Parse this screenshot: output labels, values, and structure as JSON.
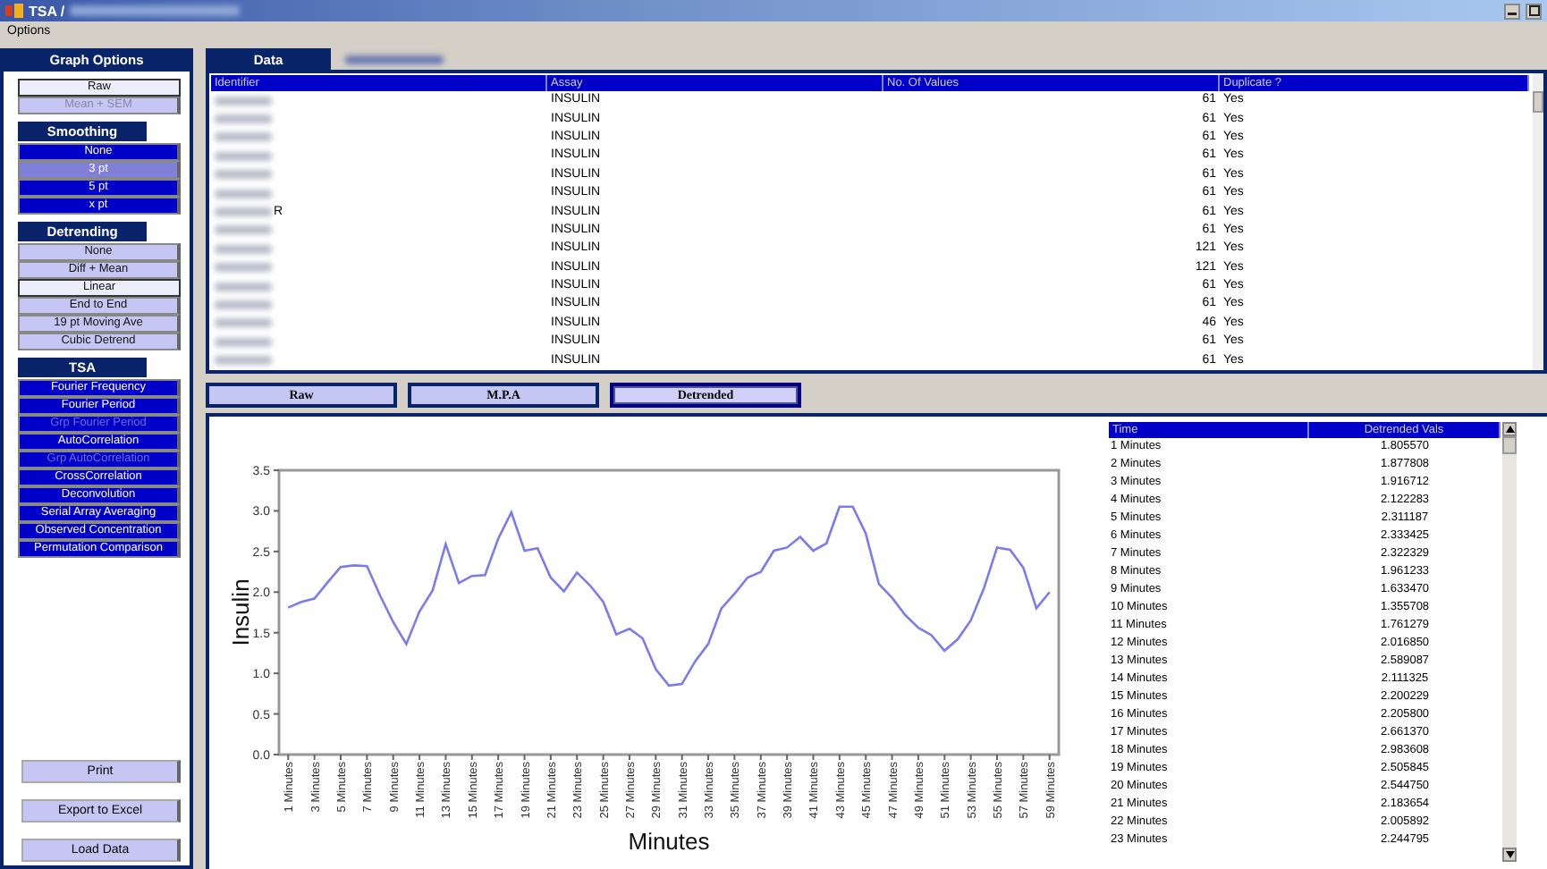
{
  "window": {
    "title": "TSA /"
  },
  "menu": [
    "Options"
  ],
  "sidebar": {
    "title": "Graph Options",
    "groups": [
      {
        "items": [
          {
            "label": "Raw",
            "selected": true,
            "disabled": false
          },
          {
            "label": "Mean + SEM",
            "selected": false,
            "disabled": true
          }
        ]
      },
      {
        "title": "Smoothing",
        "kind": "filled",
        "items": [
          {
            "label": "None",
            "selected": false,
            "disabled": false
          },
          {
            "label": "3 pt",
            "selected": true,
            "disabled": false
          },
          {
            "label": "5 pt",
            "selected": false,
            "disabled": false
          },
          {
            "label": "x pt",
            "selected": false,
            "disabled": false
          }
        ]
      },
      {
        "title": "Detrending",
        "items": [
          {
            "label": "None",
            "selected": false,
            "disabled": false
          },
          {
            "label": "Diff + Mean",
            "selected": false,
            "disabled": false
          },
          {
            "label": "Linear",
            "selected": true,
            "disabled": false
          },
          {
            "label": "End to End",
            "selected": false,
            "disabled": false
          },
          {
            "label": "19 pt Moving Ave",
            "selected": false,
            "disabled": false
          },
          {
            "label": "Cubic Detrend",
            "selected": false,
            "disabled": false
          }
        ]
      },
      {
        "title": "TSA",
        "kind": "filled",
        "items": [
          {
            "label": "Fourier Frequency",
            "selected": false,
            "disabled": false
          },
          {
            "label": "Fourier Period",
            "selected": false,
            "disabled": false
          },
          {
            "label": "Grp Fourier Period",
            "selected": false,
            "disabled": true
          },
          {
            "label": "AutoCorrelation",
            "selected": false,
            "disabled": false
          },
          {
            "label": "Grp AutoCorrelation",
            "selected": false,
            "disabled": true
          },
          {
            "label": "CrossCorrelation",
            "selected": false,
            "disabled": false
          },
          {
            "label": "Deconvolution",
            "selected": false,
            "disabled": false
          },
          {
            "label": "Serial Array Averaging",
            "selected": false,
            "disabled": false
          },
          {
            "label": "Observed Concentration",
            "selected": false,
            "disabled": false
          },
          {
            "label": "Permutation Comparison",
            "selected": false,
            "disabled": false
          }
        ]
      }
    ],
    "actions": [
      "Print",
      "Export to Excel",
      "Load Data"
    ]
  },
  "tabs": [
    {
      "label": "Data",
      "selected": true
    },
    {
      "selected": false
    }
  ],
  "table": {
    "columns": [
      "Identifier",
      "Assay",
      "No. Of Values",
      "Duplicate ?"
    ],
    "rows": [
      {
        "assay": "INSULIN",
        "values": "61",
        "duplicate": "Yes"
      },
      {
        "assay": "INSULIN",
        "values": "61",
        "duplicate": "Yes"
      },
      {
        "assay": "INSULIN",
        "values": "61",
        "duplicate": "Yes"
      },
      {
        "assay": "INSULIN",
        "values": "61",
        "duplicate": "Yes"
      },
      {
        "assay": "INSULIN",
        "values": "61",
        "duplicate": "Yes"
      },
      {
        "assay": "INSULIN",
        "values": "61",
        "duplicate": "Yes"
      },
      {
        "identifier": "R",
        "assay": "INSULIN",
        "values": "61",
        "duplicate": "Yes"
      },
      {
        "assay": "INSULIN",
        "values": "61",
        "duplicate": "Yes"
      },
      {
        "assay": "INSULIN",
        "values": "121",
        "duplicate": "Yes"
      },
      {
        "assay": "INSULIN",
        "values": "121",
        "duplicate": "Yes"
      },
      {
        "assay": "INSULIN",
        "values": "61",
        "duplicate": "Yes"
      },
      {
        "assay": "INSULIN",
        "values": "61",
        "duplicate": "Yes"
      },
      {
        "assay": "INSULIN",
        "values": "46",
        "duplicate": "Yes"
      },
      {
        "assay": "INSULIN",
        "values": "61",
        "duplicate": "Yes"
      },
      {
        "assay": "INSULIN",
        "values": "61",
        "duplicate": "Yes"
      }
    ]
  },
  "view_buttons": [
    {
      "label": "Raw",
      "selected": false
    },
    {
      "label": "M.P.A",
      "selected": false
    },
    {
      "label": "Detrended",
      "selected": true
    }
  ],
  "chart": {
    "chart_data": {
      "type": "line",
      "xlabel": "Minutes",
      "ylabel": "Insulin",
      "x": [
        1,
        2,
        3,
        4,
        5,
        6,
        7,
        8,
        9,
        10,
        11,
        12,
        13,
        14,
        15,
        16,
        17,
        18,
        19,
        20,
        21,
        22,
        23,
        24,
        25,
        26,
        27,
        28,
        29,
        30,
        31,
        32,
        33,
        34,
        35,
        36,
        37,
        38,
        39,
        40,
        41,
        42,
        43,
        44,
        45,
        46,
        47,
        48,
        49,
        50,
        51,
        52,
        53,
        54,
        55,
        56,
        57,
        58,
        59
      ],
      "xlim": [
        0.3,
        59.7
      ],
      "xticks": [
        {
          "value": 1,
          "label": "1 Minutes"
        },
        {
          "value": 3,
          "label": "3 Minutes"
        },
        {
          "value": 5,
          "label": "5 Minutes"
        },
        {
          "value": 7,
          "label": "7 Minutes"
        },
        {
          "value": 9,
          "label": "9 Minutes"
        },
        {
          "value": 11,
          "label": "11 Minutes"
        },
        {
          "value": 13,
          "label": "13 Minutes"
        },
        {
          "value": 15,
          "label": "15 Minutes"
        },
        {
          "value": 17,
          "label": "17 Minutes"
        },
        {
          "value": 19,
          "label": "19 Minutes"
        },
        {
          "value": 21,
          "label": "21 Minutes"
        },
        {
          "value": 23,
          "label": "23 Minutes"
        },
        {
          "value": 25,
          "label": "25 Minutes"
        },
        {
          "value": 27,
          "label": "27 Minutes"
        },
        {
          "value": 29,
          "label": "29 Minutes"
        },
        {
          "value": 31,
          "label": "31 Minutes"
        },
        {
          "value": 33,
          "label": "33 Minutes"
        },
        {
          "value": 35,
          "label": "35 Minutes"
        },
        {
          "value": 37,
          "label": "37 Minutes"
        },
        {
          "value": 39,
          "label": "39 Minutes"
        },
        {
          "value": 41,
          "label": "41 Minutes"
        },
        {
          "value": 43,
          "label": "43 Minutes"
        },
        {
          "value": 45,
          "label": "45 Minutes"
        },
        {
          "value": 47,
          "label": "47 Minutes"
        },
        {
          "value": 49,
          "label": "49 Minutes"
        },
        {
          "value": 51,
          "label": "51 Minutes"
        },
        {
          "value": 53,
          "label": "53 Minutes"
        },
        {
          "value": 55,
          "label": "55 Minutes"
        },
        {
          "value": 57,
          "label": "57 Minutes"
        },
        {
          "value": 59,
          "label": "59 Minutes"
        }
      ],
      "series": [
        {
          "color": "#7b7bf0",
          "values": [
            1.81,
            1.88,
            1.92,
            2.12,
            2.31,
            2.33,
            2.32,
            1.96,
            1.63,
            1.36,
            1.76,
            2.02,
            2.59,
            2.11,
            2.2,
            2.21,
            2.66,
            2.98,
            2.51,
            2.54,
            2.18,
            2.01,
            2.24,
            2.08,
            1.88,
            1.48,
            1.55,
            1.43,
            1.05,
            0.85,
            0.87,
            1.15,
            1.36,
            1.8,
            1.98,
            2.18,
            2.25,
            2.51,
            2.55,
            2.68,
            2.51,
            2.6,
            3.05,
            3.05,
            2.72,
            2.1,
            1.93,
            1.72,
            1.56,
            1.47,
            1.28,
            1.42,
            1.65,
            2.05,
            2.55,
            2.52,
            2.3,
            1.8,
            2.0
          ]
        }
      ],
      "ylim": [
        0,
        3.5
      ],
      "yticks": [
        {
          "value": 0,
          "label": "0.0"
        },
        {
          "value": 0.5,
          "label": "0.5"
        },
        {
          "value": 1,
          "label": "1.0"
        },
        {
          "value": 1.5,
          "label": "1.5"
        },
        {
          "value": 2,
          "label": "2.0"
        },
        {
          "value": 2.5,
          "label": "2.5"
        },
        {
          "value": 3,
          "label": "3.0"
        },
        {
          "value": 3.5,
          "label": "3.5"
        }
      ]
    }
  },
  "values_table": {
    "columns": [
      "Time",
      "Detrended Vals"
    ],
    "rows": [
      [
        "1 Minutes",
        "1.805570"
      ],
      [
        "2 Minutes",
        "1.877808"
      ],
      [
        "3 Minutes",
        "1.916712"
      ],
      [
        "4 Minutes",
        "2.122283"
      ],
      [
        "5 Minutes",
        "2.311187"
      ],
      [
        "6 Minutes",
        "2.333425"
      ],
      [
        "7 Minutes",
        "2.322329"
      ],
      [
        "8 Minutes",
        "1.961233"
      ],
      [
        "9 Minutes",
        "1.633470"
      ],
      [
        "10 Minutes",
        "1.355708"
      ],
      [
        "11 Minutes",
        "1.761279"
      ],
      [
        "12 Minutes",
        "2.016850"
      ],
      [
        "13 Minutes",
        "2.589087"
      ],
      [
        "14 Minutes",
        "2.111325"
      ],
      [
        "15 Minutes",
        "2.200229"
      ],
      [
        "16 Minutes",
        "2.205800"
      ],
      [
        "17 Minutes",
        "2.661370"
      ],
      [
        "18 Minutes",
        "2.983608"
      ],
      [
        "19 Minutes",
        "2.505845"
      ],
      [
        "20 Minutes",
        "2.544750"
      ],
      [
        "21 Minutes",
        "2.183654"
      ],
      [
        "22 Minutes",
        "2.005892"
      ],
      [
        "23 Minutes",
        "2.244795"
      ]
    ]
  }
}
